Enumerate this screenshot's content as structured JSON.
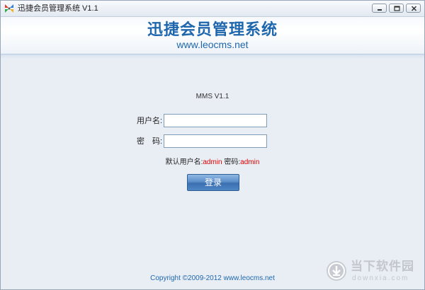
{
  "window": {
    "title": "迅捷会员管理系统 V1.1"
  },
  "header": {
    "title": "迅捷会员管理系统",
    "url": "www.leocms.net"
  },
  "login": {
    "version": "MMS V1.1",
    "username_label": "用户名:",
    "username_value": "",
    "password_label": "密　码:",
    "password_value": "",
    "hint_user_label": "默认用户名:",
    "hint_user_value": "admin",
    "hint_pass_label": " 密码:",
    "hint_pass_value": "admin",
    "button_label": "登录"
  },
  "footer": {
    "copyright": "Copyright ©2009-2012 www.leocms.net"
  },
  "watermark": {
    "name": "当下软件园",
    "domain": "downxia.com"
  },
  "colors": {
    "accent": "#1f67ad",
    "hint_value": "#e00000",
    "button": "#4f86c6"
  },
  "icons": {
    "app": "app-logo-icon",
    "minimize": "minimize-icon",
    "maximize": "maximize-icon",
    "close": "close-icon",
    "download": "download-arrow-icon"
  }
}
